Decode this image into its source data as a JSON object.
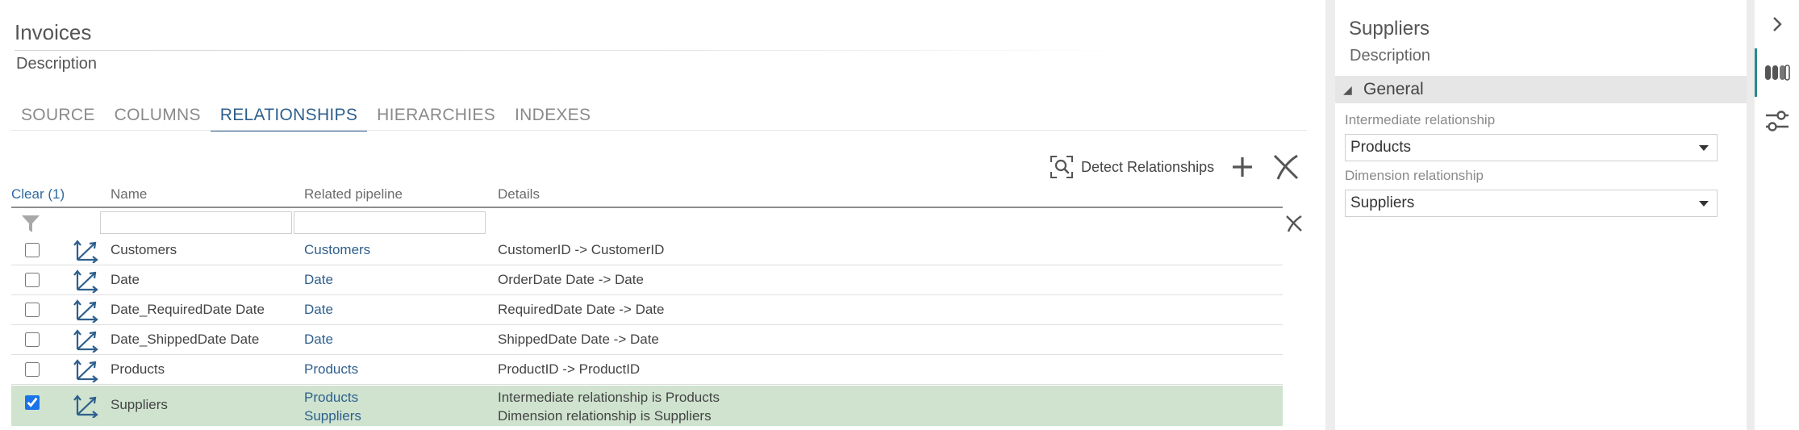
{
  "main": {
    "title": "Invoices",
    "description": "Description",
    "tabs": [
      {
        "label": "SOURCE",
        "active": false
      },
      {
        "label": "COLUMNS",
        "active": false
      },
      {
        "label": "RELATIONSHIPS",
        "active": true
      },
      {
        "label": "HIERARCHIES",
        "active": false
      },
      {
        "label": "INDEXES",
        "active": false
      }
    ],
    "toolbar": {
      "detect_label": "Detect Relationships",
      "detect_icon": "detect-search-icon",
      "add_icon": "plus-icon",
      "clear_icon": "clear-x-icon"
    },
    "grid": {
      "clear_label": "Clear (1)",
      "columns": [
        "Name",
        "Related pipeline",
        "Details"
      ],
      "filter_icon": "funnel-icon",
      "clear_filter_icon": "clear-x-icon",
      "rows": [
        {
          "checked": false,
          "name": "Customers",
          "related": [
            "Customers"
          ],
          "details": [
            "CustomerID -> CustomerID"
          ]
        },
        {
          "checked": false,
          "name": "Date",
          "related": [
            "Date"
          ],
          "details": [
            "OrderDate Date -> Date"
          ]
        },
        {
          "checked": false,
          "name": "Date_RequiredDate Date",
          "related": [
            "Date"
          ],
          "details": [
            "RequiredDate Date -> Date"
          ]
        },
        {
          "checked": false,
          "name": "Date_ShippedDate Date",
          "related": [
            "Date"
          ],
          "details": [
            "ShippedDate Date -> Date"
          ]
        },
        {
          "checked": false,
          "name": "Products",
          "related": [
            "Products"
          ],
          "details": [
            "ProductID -> ProductID"
          ]
        },
        {
          "checked": true,
          "name": "Suppliers",
          "related": [
            "Products",
            "Suppliers"
          ],
          "details": [
            "Intermediate relationship is Products",
            "Dimension relationship is Suppliers"
          ]
        }
      ]
    }
  },
  "props": {
    "title": "Suppliers",
    "description": "Description",
    "section": "General",
    "fields": [
      {
        "label": "Intermediate relationship",
        "value": "Products"
      },
      {
        "label": "Dimension relationship",
        "value": "Suppliers"
      }
    ]
  },
  "strip": {
    "icons": [
      "chevron-right-icon",
      "columns-icon",
      "settings-sliders-icon"
    ]
  },
  "colors": {
    "accent": "#2e5f8c",
    "selected_row": "#cfe3cf",
    "strip_active": "#2a8a8a"
  }
}
